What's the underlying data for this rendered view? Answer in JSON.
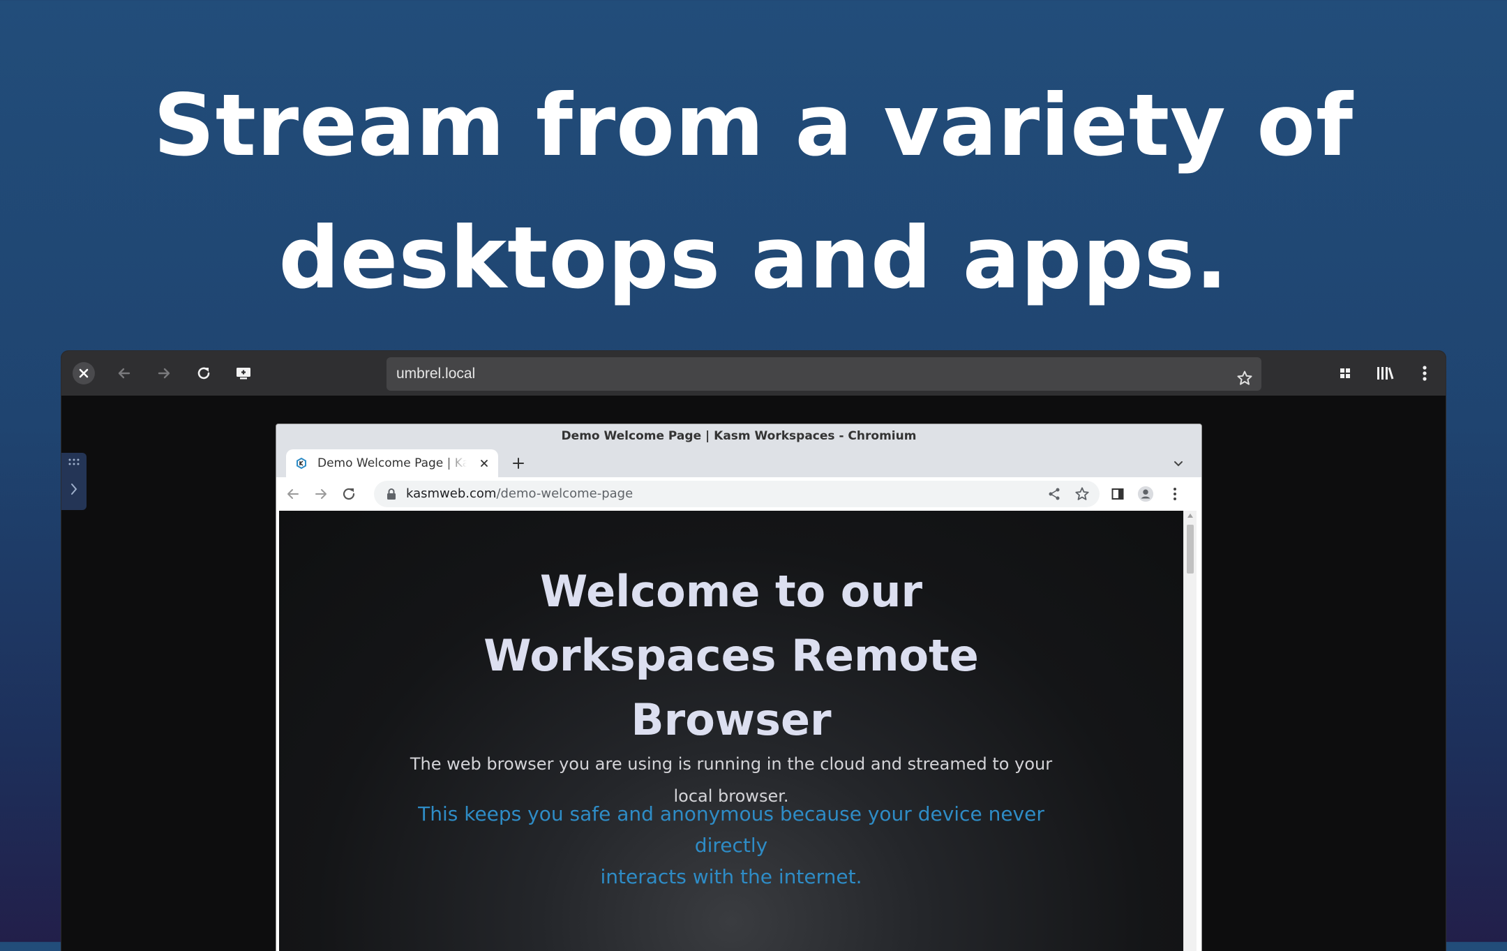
{
  "headline": {
    "line1": "Stream from a variety of",
    "line2": "desktops and apps."
  },
  "outer_browser": {
    "url": "umbrel.local",
    "icons": [
      "close-icon",
      "back-icon",
      "forward-icon",
      "reload-icon",
      "add-desktop-icon",
      "star-icon",
      "grid-icon",
      "library-icon",
      "more-icon"
    ]
  },
  "inner_window": {
    "title": "Demo Welcome Page | Kasm Workspaces - Chromium",
    "tab_title": "Demo Welcome Page | Kasm Workspaces",
    "url_host": "kasmweb.com",
    "url_path": "/demo-welcome-page"
  },
  "page": {
    "heading_line1": "Welcome to our",
    "heading_line2": "Workspaces Remote",
    "heading_line3": "Browser",
    "sub_line1": "The web browser you are using is running in the cloud and streamed to your",
    "sub_line2": "local browser.",
    "blue_line1": "This keeps you safe and anonymous because your device never",
    "blue_line2": "directly",
    "blue_line3": "interacts with the internet."
  },
  "colors": {
    "accent_blue": "#2e8cc6",
    "background_top": "#224d7a",
    "background_bottom": "#221f4a"
  }
}
